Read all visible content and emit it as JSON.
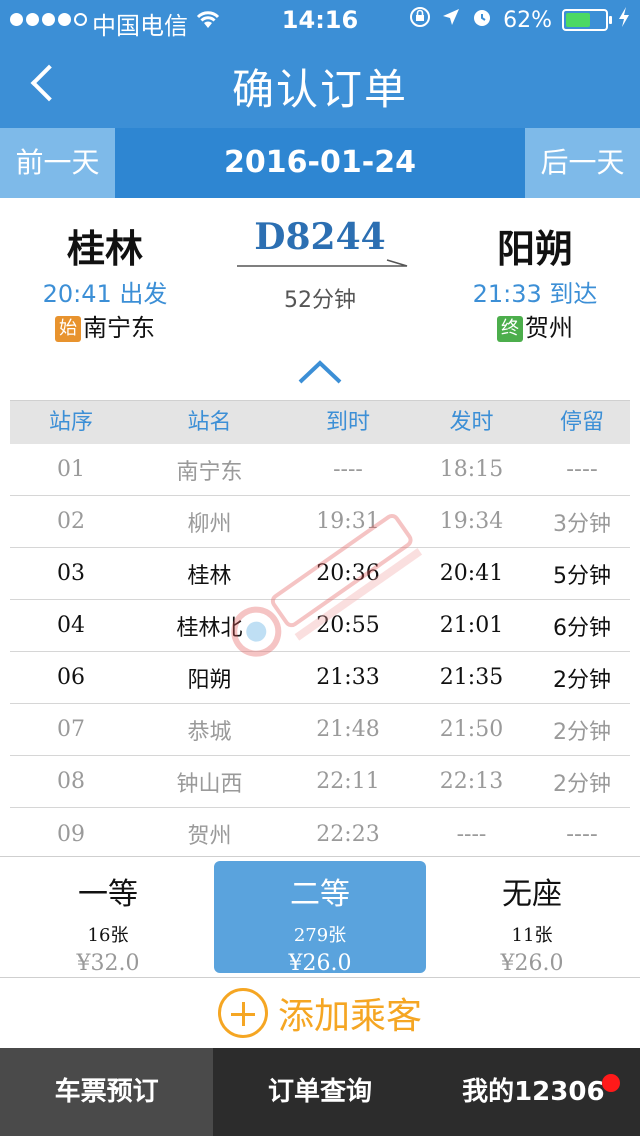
{
  "status_bar": {
    "carrier": "中国电信",
    "time": "14:16",
    "battery": "62%",
    "battery_level": 0.62
  },
  "nav": {
    "title": "确认订单"
  },
  "date_bar": {
    "prev_label": "前一天",
    "date": "2016-01-24",
    "next_label": "后一天"
  },
  "train": {
    "number": "D8244",
    "duration": "52分钟",
    "from_station": "桂林",
    "from_time": "20:41 出发",
    "origin_tag": "始",
    "origin": "南宁东",
    "to_station": "阳朔",
    "to_time": "21:33 到达",
    "terminal_tag": "终",
    "terminal": "贺州"
  },
  "stops": {
    "headers": [
      "站序",
      "站名",
      "到时",
      "发时",
      "停留"
    ],
    "rows": [
      {
        "no": "01",
        "name": "南宁东",
        "arrive": "----",
        "depart": "18:15",
        "stay": "----"
      },
      {
        "no": "02",
        "name": "柳州",
        "arrive": "19:31",
        "depart": "19:34",
        "stay": "3分钟"
      },
      {
        "no": "03",
        "name": "桂林",
        "arrive": "20:36",
        "depart": "20:41",
        "stay": "5分钟"
      },
      {
        "no": "04",
        "name": "桂林北",
        "arrive": "20:55",
        "depart": "21:01",
        "stay": "6分钟"
      },
      {
        "no": "06",
        "name": "阳朔",
        "arrive": "21:33",
        "depart": "21:35",
        "stay": "2分钟"
      },
      {
        "no": "07",
        "name": "恭城",
        "arrive": "21:48",
        "depart": "21:50",
        "stay": "2分钟"
      },
      {
        "no": "08",
        "name": "钟山西",
        "arrive": "22:11",
        "depart": "22:13",
        "stay": "2分钟"
      },
      {
        "no": "09",
        "name": "贺州",
        "arrive": "22:23",
        "depart": "----",
        "stay": "----"
      }
    ]
  },
  "seats": [
    {
      "name": "一等",
      "count": "16张",
      "price": "¥32.0"
    },
    {
      "name": "二等",
      "count": "279张",
      "price": "¥26.0"
    },
    {
      "name": "无座",
      "count": "11张",
      "price": "¥26.0"
    }
  ],
  "add_passenger": {
    "label": "添加乘客"
  },
  "tabs": [
    {
      "label": "车票预订"
    },
    {
      "label": "订单查询"
    },
    {
      "label": "我的12306"
    }
  ],
  "colors": {
    "nav_blue": "#3c8fd6",
    "accent_orange": "#f5a623",
    "selected_seat": "#5aa3dd",
    "badge_red": "#ff1a1a"
  }
}
